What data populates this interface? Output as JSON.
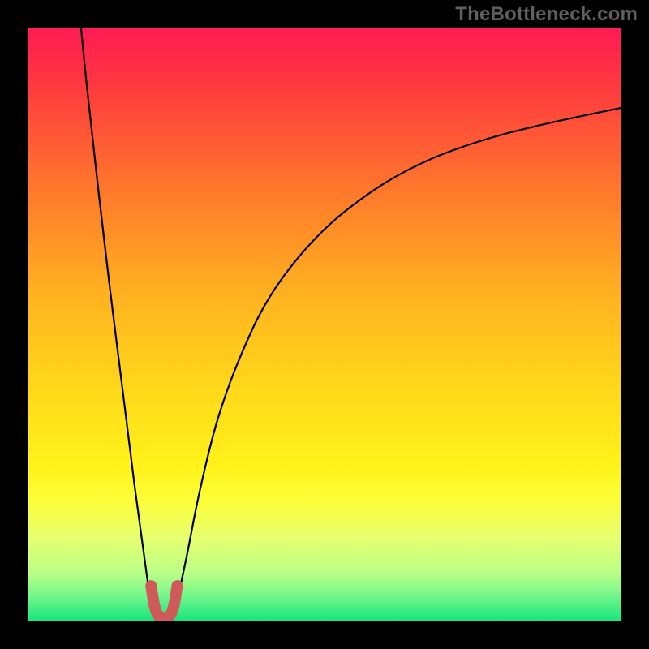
{
  "watermark": "TheBottleneck.com",
  "chart_data": {
    "type": "line",
    "title": "",
    "xlabel": "",
    "ylabel": "",
    "xlim": [
      0,
      100
    ],
    "ylim": [
      0,
      100
    ],
    "grid": false,
    "gradient_stops": [
      {
        "offset": 0.0,
        "color": "#ff1a54"
      },
      {
        "offset": 0.1,
        "color": "#ff3a3f"
      },
      {
        "offset": 0.28,
        "color": "#ff7a2b"
      },
      {
        "offset": 0.45,
        "color": "#ffb220"
      },
      {
        "offset": 0.6,
        "color": "#ffd61a"
      },
      {
        "offset": 0.74,
        "color": "#fff31a"
      },
      {
        "offset": 0.8,
        "color": "#fbff3b"
      },
      {
        "offset": 0.86,
        "color": "#e6ff70"
      },
      {
        "offset": 0.92,
        "color": "#b8ff87"
      },
      {
        "offset": 0.96,
        "color": "#6cf58b"
      },
      {
        "offset": 1.0,
        "color": "#14e57c"
      }
    ],
    "series": [
      {
        "name": "left-branch",
        "color": "#000000",
        "x": [
          9.0,
          10.0,
          12.0,
          14.0,
          16.0,
          18.0,
          19.5,
          20.5,
          21.3
        ],
        "y": [
          100.0,
          90.0,
          72.0,
          55.0,
          39.0,
          23.0,
          12.0,
          5.0,
          2.0
        ]
      },
      {
        "name": "right-branch",
        "color": "#000000",
        "x": [
          24.5,
          25.5,
          27.0,
          29.0,
          32.0,
          36.0,
          41.0,
          48.0,
          56.0,
          65.0,
          75.0,
          86.0,
          100.0
        ],
        "y": [
          2.0,
          5.0,
          12.0,
          22.0,
          34.0,
          45.0,
          55.0,
          64.0,
          71.0,
          76.5,
          80.5,
          83.5,
          86.5
        ]
      },
      {
        "name": "trough-highlight",
        "color": "#d05a5a",
        "x": [
          20.8,
          21.2,
          21.6,
          22.2,
          23.0,
          23.8,
          24.4,
          24.8,
          25.2
        ],
        "y": [
          6.0,
          3.5,
          1.8,
          0.8,
          0.5,
          0.8,
          1.8,
          3.5,
          6.0
        ]
      }
    ],
    "legend": false
  }
}
